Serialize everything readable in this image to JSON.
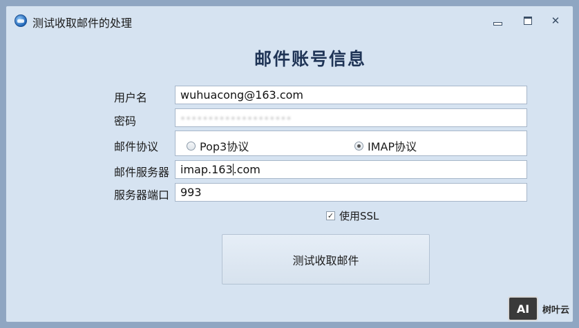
{
  "window": {
    "title": "测试收取邮件的处理"
  },
  "form": {
    "heading": "邮件账号信息",
    "username_label": "用户名",
    "username_value": "wuhuacong@163.com",
    "password_label": "密码",
    "password_value": "••••••••••••••••••••",
    "protocol_label": "邮件协议",
    "protocol_options": [
      {
        "label": "Pop3协议",
        "selected": false
      },
      {
        "label": "IMAP协议",
        "selected": true
      }
    ],
    "server_label": "邮件服务器",
    "server_value_before_cursor": "imap.163",
    "server_value_after_cursor": ".com",
    "port_label": "服务器端口",
    "port_value": "993",
    "ssl_label": "使用SSL",
    "ssl_checked": true,
    "submit_label": "测试收取邮件"
  },
  "watermark": {
    "logo_text": "AI",
    "text": "树叶云"
  },
  "colors": {
    "window_bg": "#d6e3f1",
    "heading": "#1f3456",
    "field_border": "#a6b6c9"
  }
}
